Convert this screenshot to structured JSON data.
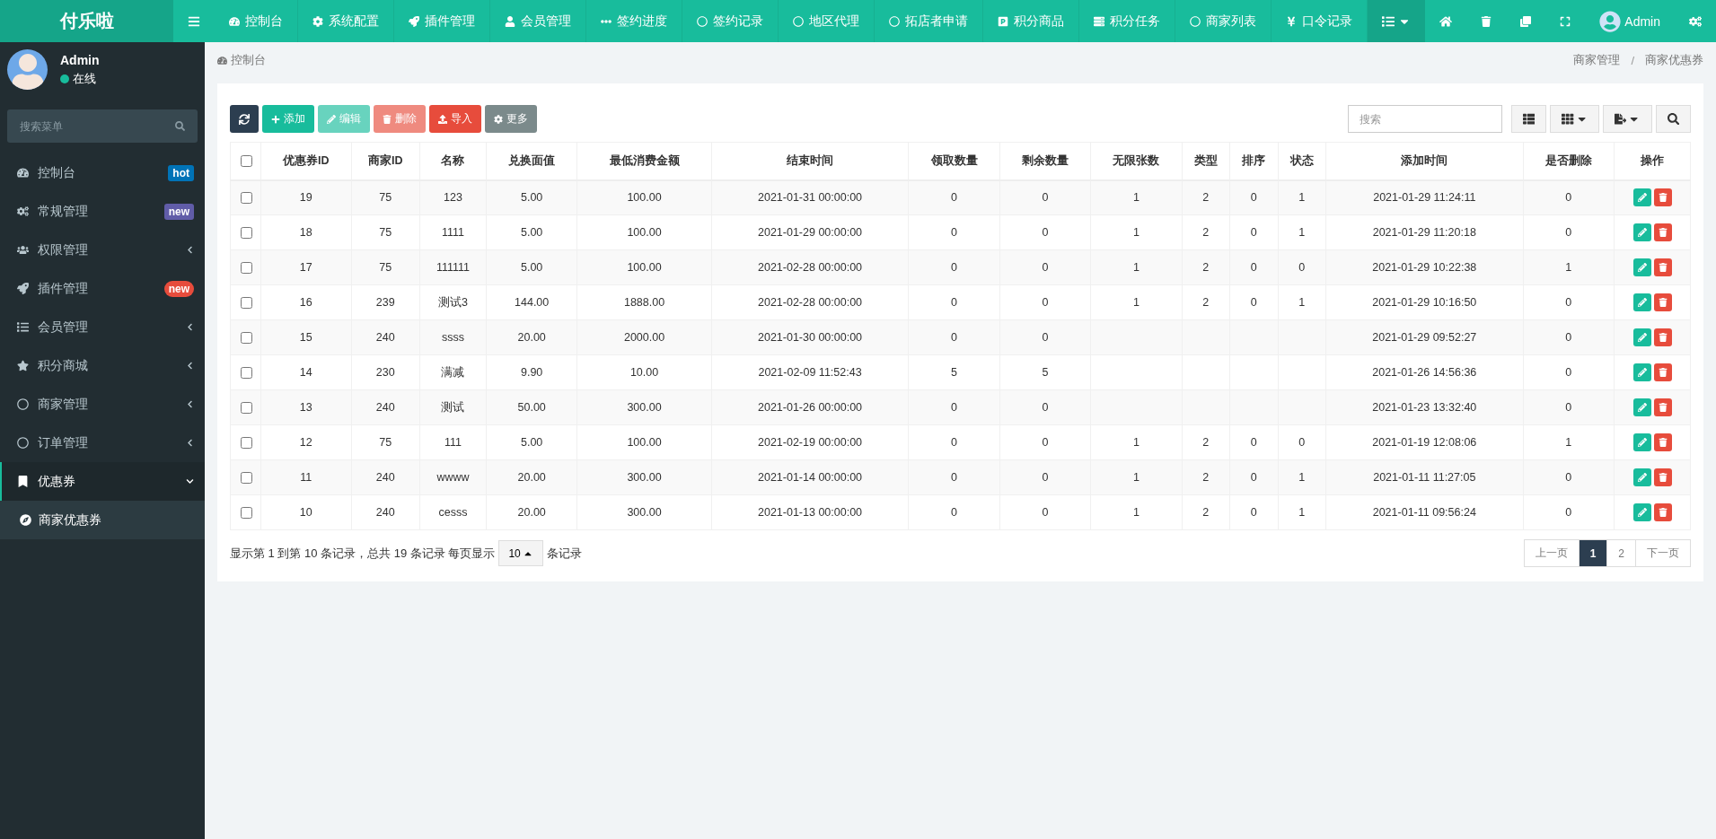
{
  "brand": "付乐啦",
  "top_nav": [
    {
      "label": "控制台"
    },
    {
      "label": "系统配置"
    },
    {
      "label": "插件管理"
    },
    {
      "label": "会员管理"
    },
    {
      "label": "签约进度"
    },
    {
      "label": "签约记录"
    },
    {
      "label": "地区代理"
    },
    {
      "label": "拓店者申请"
    },
    {
      "label": "积分商品"
    },
    {
      "label": "积分任务"
    },
    {
      "label": "商家列表"
    },
    {
      "label": "口令记录"
    }
  ],
  "top_user": {
    "name": "Admin"
  },
  "user": {
    "name": "Admin",
    "status": "在线"
  },
  "sidebar": {
    "search_placeholder": "搜索菜单",
    "items": [
      {
        "label": "控制台",
        "badge": "hot",
        "color": "#0073b7",
        "selected": false
      },
      {
        "label": "常规管理",
        "badge": "new",
        "color": "#605ca8",
        "selected": false
      },
      {
        "label": "权限管理",
        "expanded": false,
        "selected": false
      },
      {
        "label": "插件管理",
        "badge": "new",
        "color": "#e74c3c",
        "selected": false
      },
      {
        "label": "会员管理",
        "expanded": false,
        "selected": false
      },
      {
        "label": "积分商城",
        "expanded": false,
        "selected": false
      },
      {
        "label": "商家管理",
        "expanded": false,
        "selected": false
      },
      {
        "label": "订单管理",
        "expanded": false,
        "selected": false
      },
      {
        "label": "优惠券",
        "expanded": true,
        "selected": true,
        "children": [
          {
            "label": "商家优惠券",
            "selected": true
          }
        ]
      }
    ]
  },
  "breadcrumb": {
    "page_title": "控制台",
    "trail": [
      "商家管理",
      "商家优惠券"
    ],
    "separator": "/"
  },
  "toolbar": {
    "buttons": [
      {
        "label": "添加",
        "disabled": false
      },
      {
        "label": "编辑",
        "disabled": true
      },
      {
        "label": "删除",
        "disabled": true
      },
      {
        "label": "导入",
        "disabled": false
      },
      {
        "label": "更多",
        "disabled": false
      }
    ],
    "search_placeholder": "搜索"
  },
  "table": {
    "select_all_checked": false,
    "columns": [
      "优惠券ID",
      "商家ID",
      "名称",
      "兑换面值",
      "最低消费金额",
      "结束时间",
      "领取数量",
      "剩余数量",
      "无限张数",
      "类型",
      "排序",
      "状态",
      "添加时间",
      "是否删除",
      "操作"
    ],
    "rows": [
      {
        "checked": false,
        "cells": [
          "19",
          "75",
          "123",
          "5.00",
          "100.00",
          "2021-01-31 00:00:00",
          "0",
          "0",
          "1",
          "2",
          "0",
          "1",
          "2021-01-29 11:24:11",
          "0"
        ]
      },
      {
        "checked": false,
        "cells": [
          "18",
          "75",
          "1111",
          "5.00",
          "100.00",
          "2021-01-29 00:00:00",
          "0",
          "0",
          "1",
          "2",
          "0",
          "1",
          "2021-01-29 11:20:18",
          "0"
        ]
      },
      {
        "checked": false,
        "cells": [
          "17",
          "75",
          "111111",
          "5.00",
          "100.00",
          "2021-02-28 00:00:00",
          "0",
          "0",
          "1",
          "2",
          "0",
          "0",
          "2021-01-29 10:22:38",
          "1"
        ]
      },
      {
        "checked": false,
        "cells": [
          "16",
          "239",
          "测试3",
          "144.00",
          "1888.00",
          "2021-02-28 00:00:00",
          "0",
          "0",
          "1",
          "2",
          "0",
          "1",
          "2021-01-29 10:16:50",
          "0"
        ]
      },
      {
        "checked": false,
        "cells": [
          "15",
          "240",
          "ssss",
          "20.00",
          "2000.00",
          "2021-01-30 00:00:00",
          "0",
          "0",
          null,
          null,
          null,
          null,
          "2021-01-29 09:52:27",
          "0"
        ]
      },
      {
        "checked": false,
        "cells": [
          "14",
          "230",
          "满减",
          "9.90",
          "10.00",
          "2021-02-09 11:52:43",
          "5",
          "5",
          null,
          null,
          null,
          null,
          "2021-01-26 14:56:36",
          "0"
        ]
      },
      {
        "checked": false,
        "cells": [
          "13",
          "240",
          "测试",
          "50.00",
          "300.00",
          "2021-01-26 00:00:00",
          "0",
          "0",
          null,
          null,
          null,
          null,
          "2021-01-23 13:32:40",
          "0"
        ]
      },
      {
        "checked": false,
        "cells": [
          "12",
          "75",
          "111",
          "5.00",
          "100.00",
          "2021-02-19 00:00:00",
          "0",
          "0",
          "1",
          "2",
          "0",
          "0",
          "2021-01-19 12:08:06",
          "1"
        ]
      },
      {
        "checked": false,
        "cells": [
          "11",
          "240",
          "wwww",
          "20.00",
          "300.00",
          "2021-01-14 00:00:00",
          "0",
          "0",
          "1",
          "2",
          "0",
          "1",
          "2021-01-11 11:27:05",
          "0"
        ]
      },
      {
        "checked": false,
        "cells": [
          "10",
          "240",
          "cesss",
          "20.00",
          "300.00",
          "2021-01-13 00:00:00",
          "0",
          "0",
          "1",
          "2",
          "0",
          "1",
          "2021-01-11 09:56:24",
          "0"
        ]
      }
    ]
  },
  "footer": {
    "summary": "显示第 1 到第 10 条记录，总共 19 条记录 每页显示",
    "page_size": "10",
    "suffix": "条记录",
    "pages": [
      {
        "label": "上一页",
        "selected": false
      },
      {
        "label": "1",
        "selected": true
      },
      {
        "label": "2",
        "selected": false
      },
      {
        "label": "下一页",
        "selected": false
      }
    ]
  }
}
